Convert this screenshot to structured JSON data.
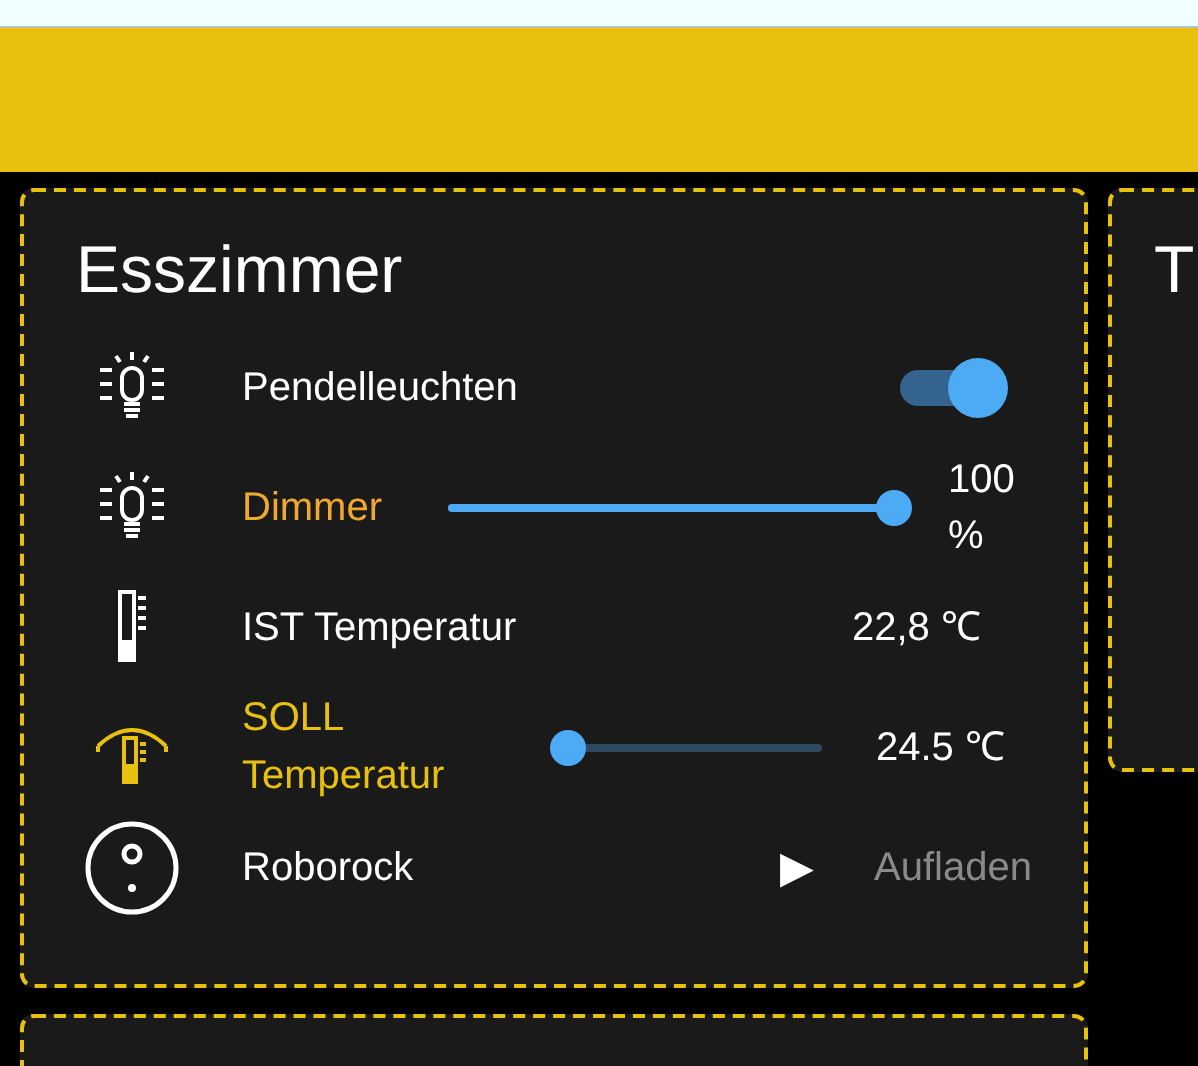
{
  "cards": [
    {
      "title": "Esszimmer",
      "rows": [
        {
          "kind": "toggle",
          "label": "Pendelleuchten",
          "on": true
        },
        {
          "kind": "slider",
          "label": "Dimmer",
          "color": "#f0a830",
          "level": 1,
          "reading": "100 %"
        },
        {
          "kind": "sensor",
          "label": "IST Temperatur",
          "reading": "22,8 ℃"
        },
        {
          "kind": "slider",
          "label": "SOLL Temperatur",
          "color": "#e8c10f",
          "level": 0,
          "reading": "24.5 ℃"
        },
        {
          "kind": "action",
          "label": "Roborock",
          "button": "▶",
          "status": "Aufladen"
        }
      ]
    },
    {
      "title": "T"
    }
  ]
}
